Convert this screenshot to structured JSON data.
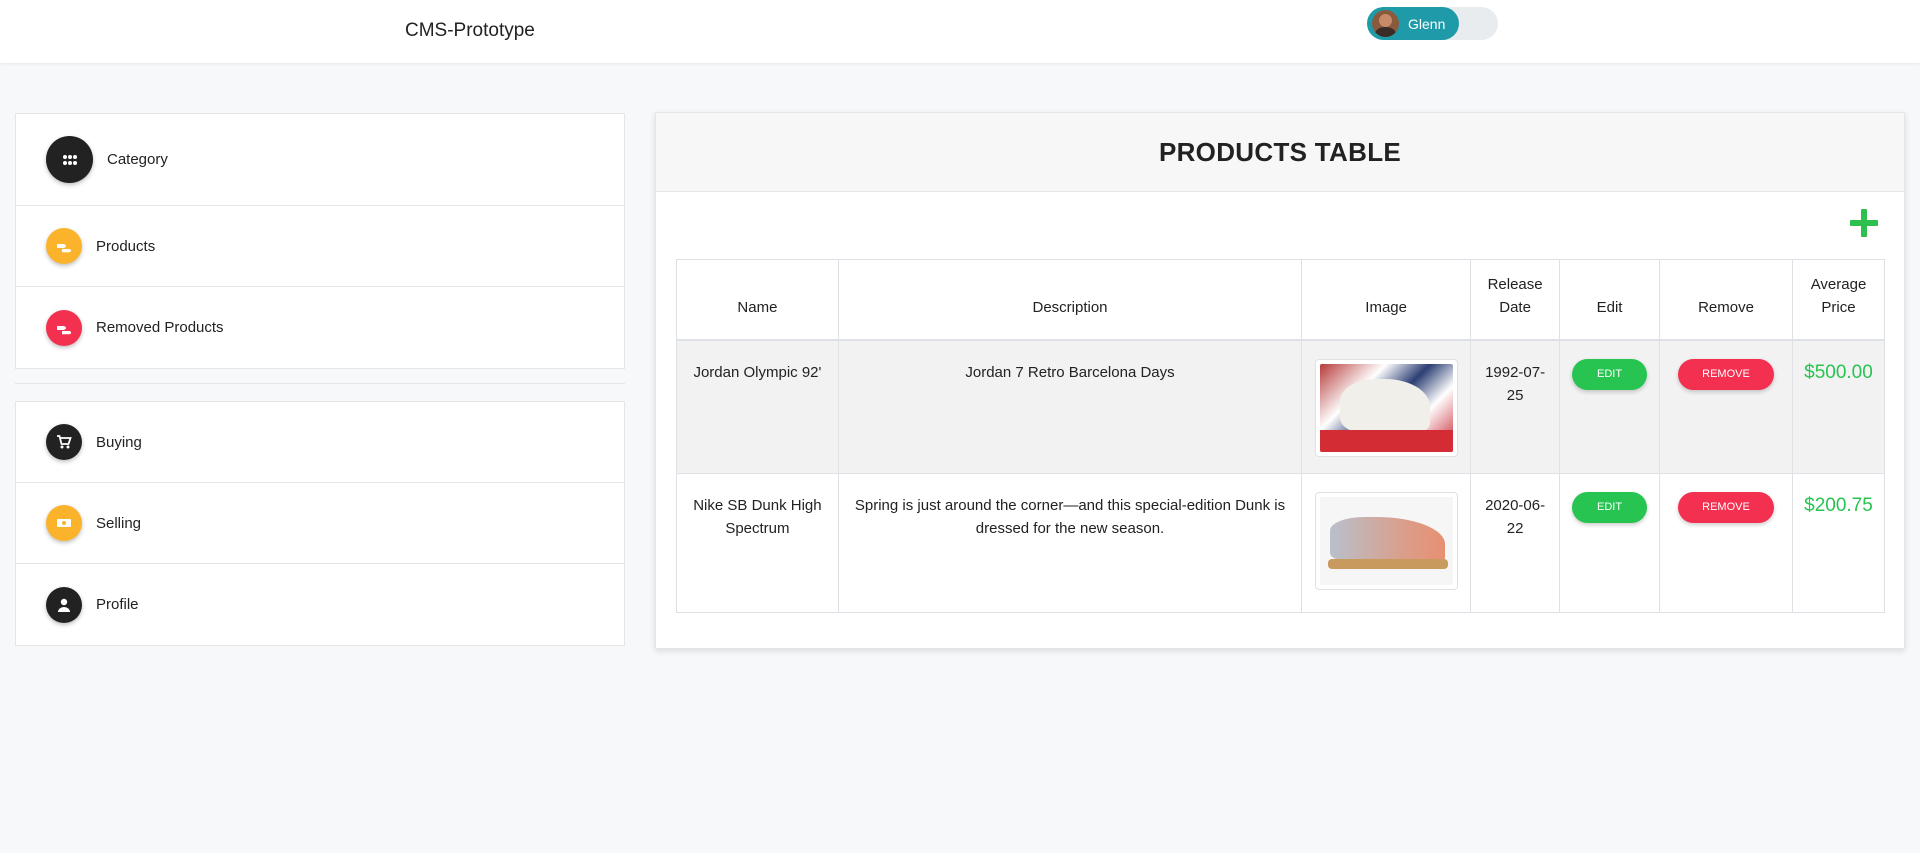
{
  "header": {
    "brand": "CMS-Prototype",
    "user_name": "Glenn"
  },
  "sidebar": {
    "group1": [
      {
        "label": "Category",
        "icon": "grid-icon",
        "color": "#222222"
      },
      {
        "label": "Products",
        "icon": "shoe-icon",
        "color": "#fbb32c"
      },
      {
        "label": "Removed Products",
        "icon": "shoe-icon",
        "color": "#f43050"
      }
    ],
    "group2": [
      {
        "label": "Buying",
        "icon": "cart-icon",
        "color": "#222222"
      },
      {
        "label": "Selling",
        "icon": "money-icon",
        "color": "#fbb32c"
      },
      {
        "label": "Profile",
        "icon": "user-icon",
        "color": "#222222"
      }
    ]
  },
  "main": {
    "title": "PRODUCTS TABLE",
    "columns": [
      "Name",
      "Description",
      "Image",
      "Release Date",
      "Edit",
      "Remove",
      "Average Price"
    ],
    "rows": [
      {
        "name": "Jordan Olympic 92'",
        "description": "Jordan 7 Retro Barcelona Days",
        "image": "shoe-photo",
        "release_date": "1992-07-25",
        "edit_label": "EDIT",
        "remove_label": "REMOVE",
        "price": "$500.00"
      },
      {
        "name": "Nike SB Dunk High Spectrum",
        "description": "Spring is just around the corner—and this special-edition Dunk is dressed for the new season.",
        "image": "shoe-photo",
        "release_date": "2020-06-22",
        "edit_label": "EDIT",
        "remove_label": "REMOVE",
        "price": "$200.75"
      }
    ]
  },
  "colors": {
    "accent_teal": "#1e9aa8",
    "success": "#28c451",
    "danger": "#f43050",
    "warning": "#fbb32c"
  }
}
